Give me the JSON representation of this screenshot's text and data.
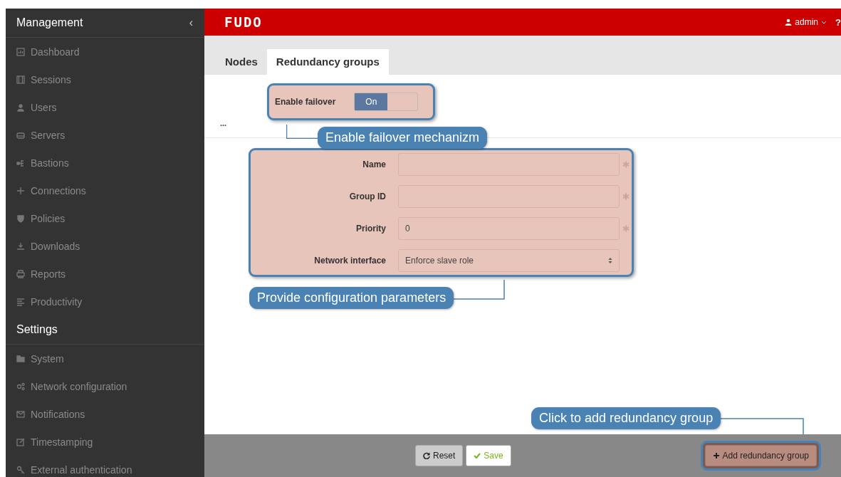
{
  "sidebar": {
    "sections": [
      {
        "title": "Management",
        "collapse": "‹",
        "items": [
          {
            "label": "Dashboard"
          },
          {
            "label": "Sessions"
          },
          {
            "label": "Users"
          },
          {
            "label": "Servers"
          },
          {
            "label": "Bastions"
          },
          {
            "label": "Connections"
          },
          {
            "label": "Policies"
          },
          {
            "label": "Downloads"
          },
          {
            "label": "Reports"
          },
          {
            "label": "Productivity"
          }
        ]
      },
      {
        "title": "Settings",
        "items": [
          {
            "label": "System"
          },
          {
            "label": "Network configuration"
          },
          {
            "label": "Notifications"
          },
          {
            "label": "Timestamping"
          },
          {
            "label": "External authentication"
          }
        ]
      }
    ]
  },
  "header": {
    "logo": "FUDO",
    "user": "admin",
    "help": "?"
  },
  "tabs": [
    {
      "label": "Nodes",
      "selected": false
    },
    {
      "label": "Redundancy groups",
      "selected": true
    }
  ],
  "failover": {
    "label": "Enable failover",
    "toggle_label": "On",
    "on": true
  },
  "ellipsis": "...",
  "form": {
    "fields": [
      {
        "kind": "input",
        "label": "Name",
        "required": true
      },
      {
        "kind": "input",
        "label": "Group ID",
        "required": true
      },
      {
        "kind": "input",
        "label": "Priority",
        "value": "0",
        "required": true
      },
      {
        "kind": "select",
        "label": "Network interface",
        "value": "Enforce slave role",
        "required": false
      }
    ]
  },
  "callouts": [
    "Enable failover mechanizm",
    "Provide configuration parameters",
    "Click to add redundancy group"
  ],
  "footer": {
    "reset": "Reset",
    "save": "Save",
    "add": "Add redundancy group"
  }
}
